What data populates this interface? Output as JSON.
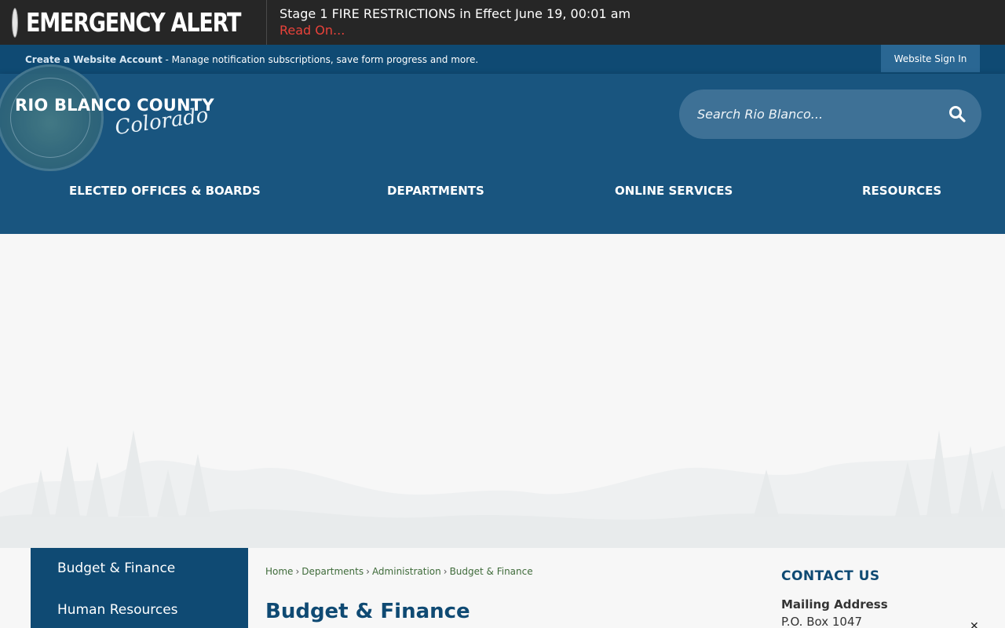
{
  "alert": {
    "title": "EMERGENCY ALERT",
    "message": "Stage 1 FIRE RESTRICTIONS in Effect June 19, 00:01 am",
    "link_label": "Read On..."
  },
  "account": {
    "create_link": "Create a Website Account",
    "description": " - Manage notification subscriptions, save form progress and more.",
    "signin_label": "Website Sign In"
  },
  "header": {
    "logo_title": "RIO BLANCO COUNTY",
    "logo_script": "Colorado",
    "search_placeholder": "Search Rio Blanco...",
    "nav": [
      "ELECTED OFFICES & BOARDS",
      "DEPARTMENTS",
      "ONLINE SERVICES",
      "RESOURCES"
    ]
  },
  "sidebar": {
    "items": [
      "Budget & Finance",
      "Human Resources"
    ]
  },
  "breadcrumb": [
    "Home",
    "Departments",
    "Administration",
    "Budget & Finance"
  ],
  "breadcrumb_separator": "›",
  "page_title": "Budget & Finance",
  "contact": {
    "title": "CONTACT US",
    "mailing_label": "Mailing Address",
    "mailing_line1": "P.O. Box 1047"
  },
  "colors": {
    "alert_bg": "#262626",
    "account_bg": "#0f4a73",
    "header_bg": "#19557f",
    "alert_link": "#e8423a",
    "title_blue": "#0f4a73",
    "breadcrumb_green": "#3f6b3a"
  },
  "icons": {
    "alert": "red-dot-icon",
    "search": "magnifier-icon",
    "close": "close-icon"
  }
}
